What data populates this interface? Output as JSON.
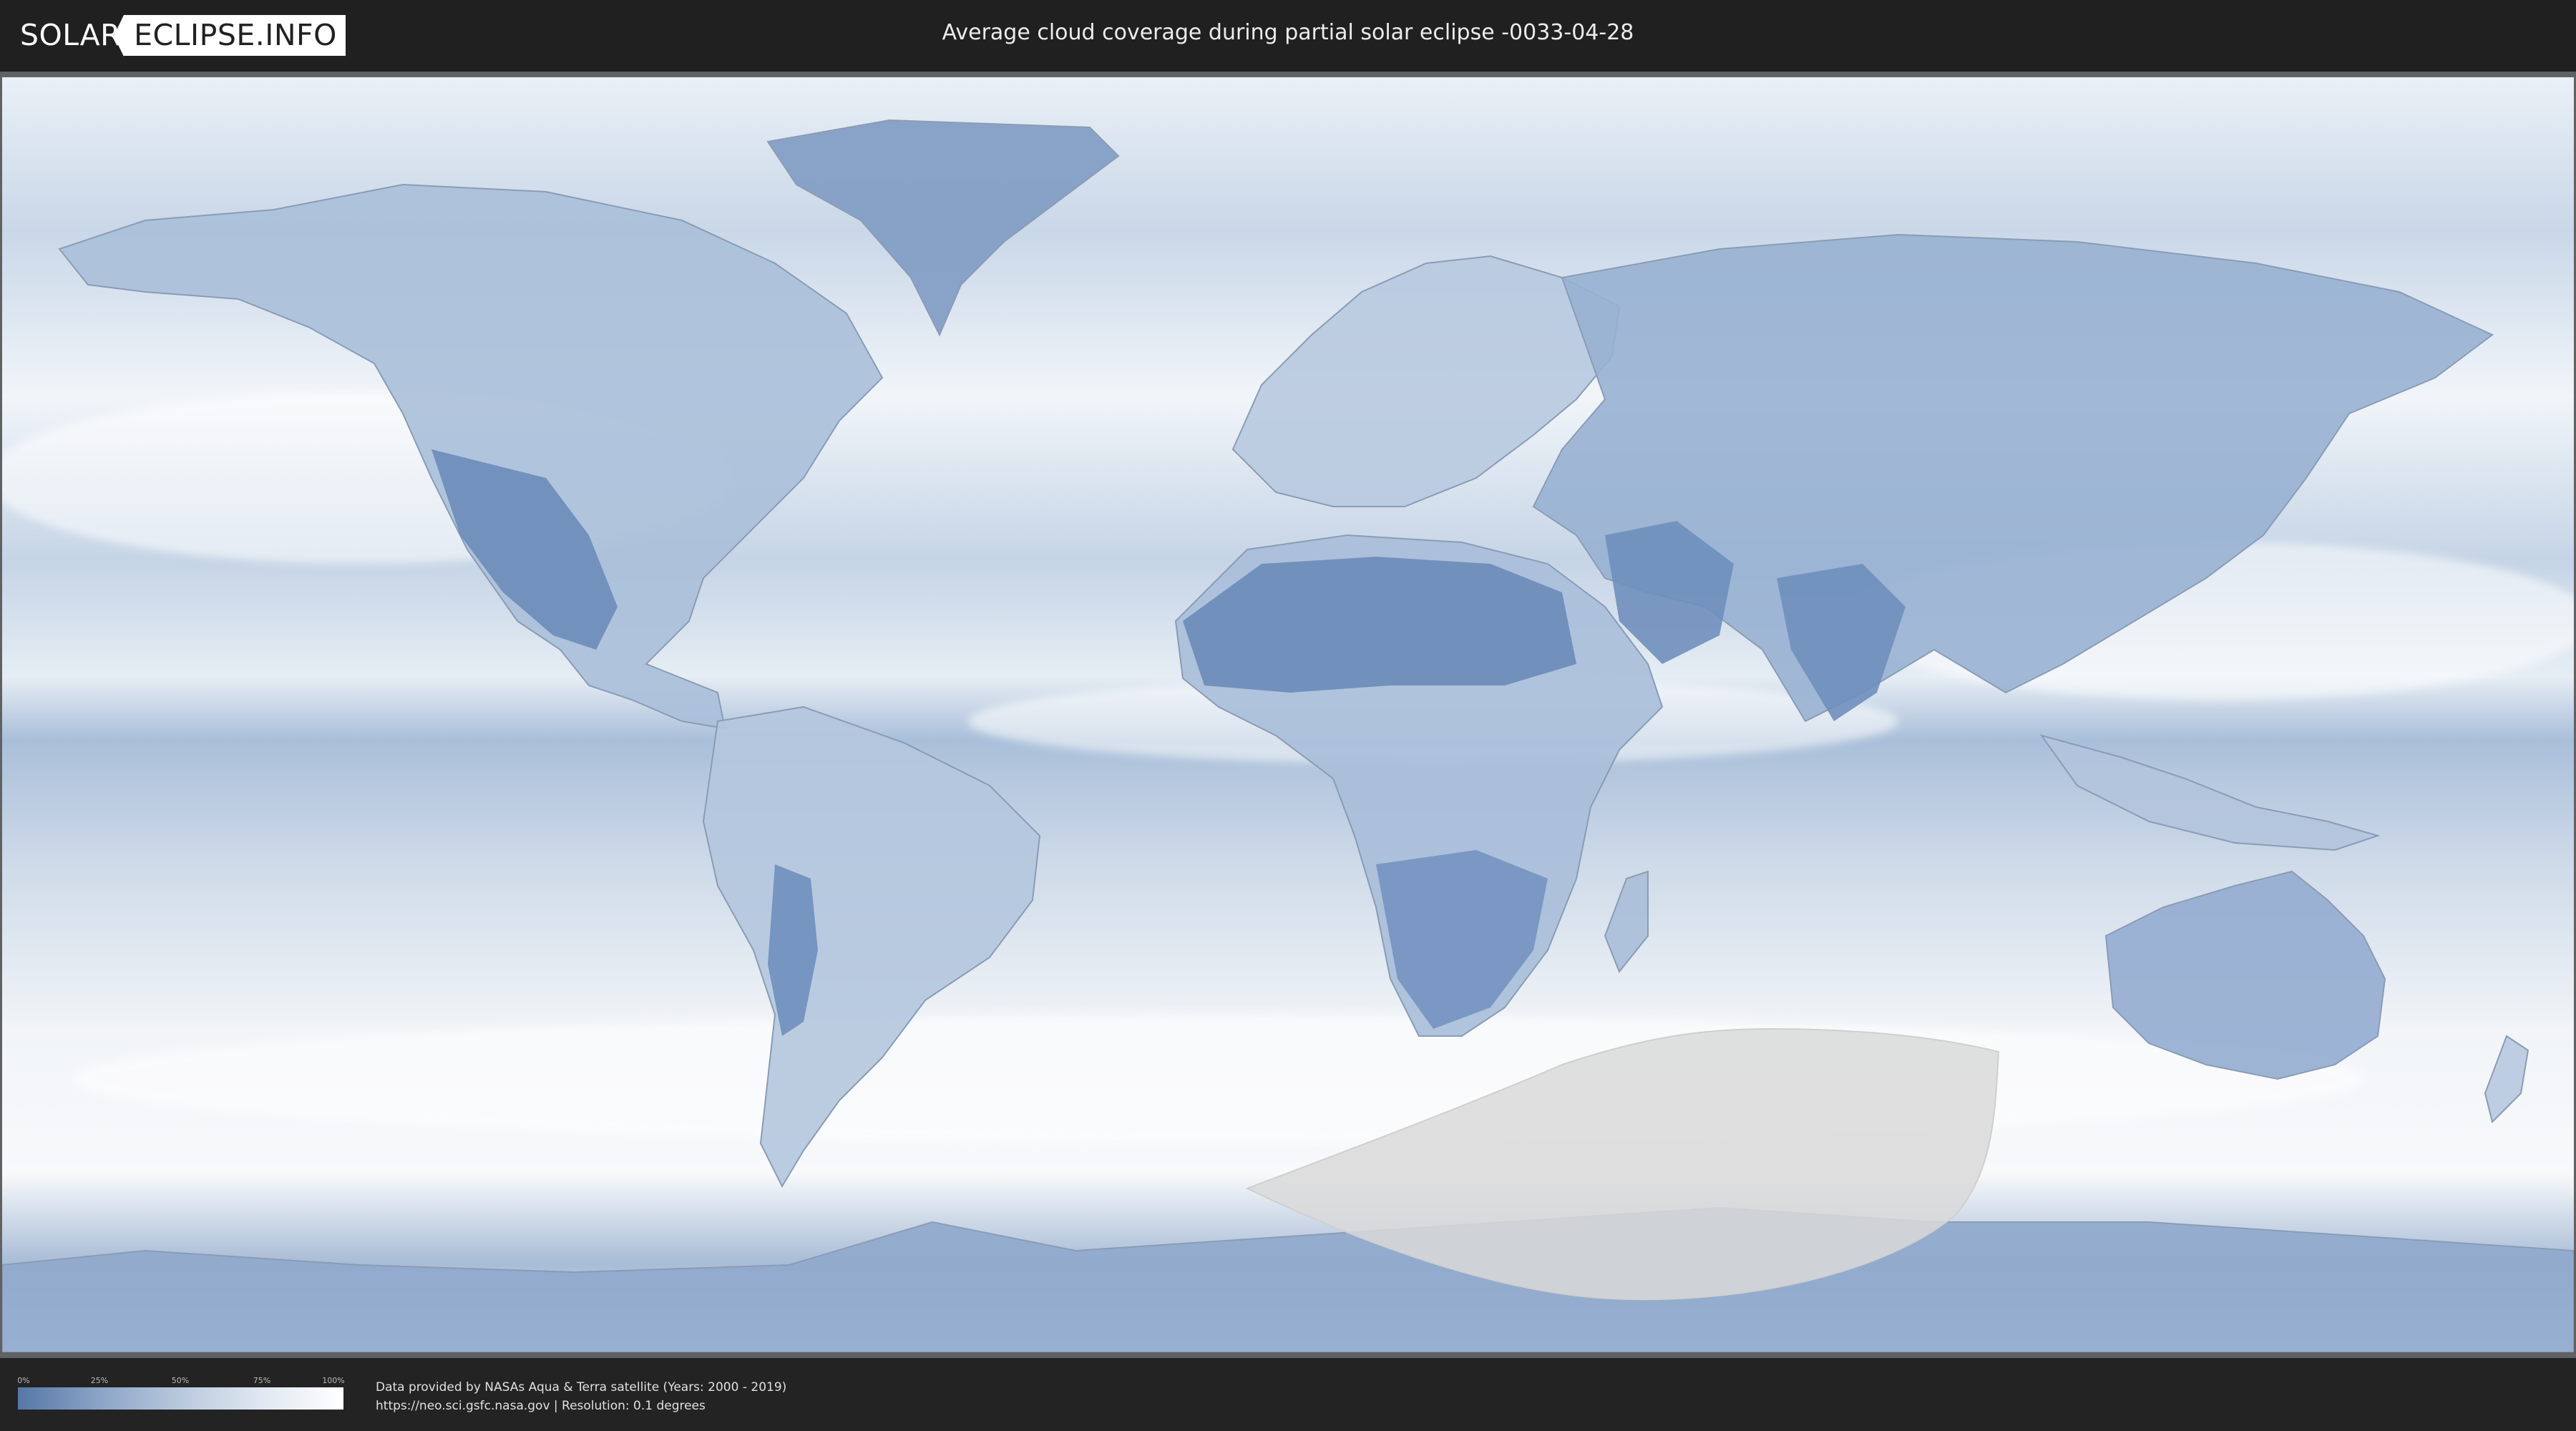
{
  "header": {
    "logo_left": "SOLAR",
    "logo_right": "ECLIPSE.INFO",
    "title": "Average cloud coverage during partial solar eclipse -0033-04-28"
  },
  "map": {
    "ocean_color": "#dfe8f2",
    "land_color": "#7d98c0",
    "eclipse_zone_color": "#d9d9d9"
  },
  "legend": {
    "ticks": [
      "0%",
      "25%",
      "50%",
      "75%",
      "100%"
    ],
    "min_color": "#5677a6",
    "max_color": "#ffffff"
  },
  "credits": {
    "line1": "Data provided by NASAs Aqua & Terra satellite (Years: 2000 - 2019)",
    "line2": "https://neo.sci.gsfc.nasa.gov | Resolution: 0.1 degrees"
  }
}
